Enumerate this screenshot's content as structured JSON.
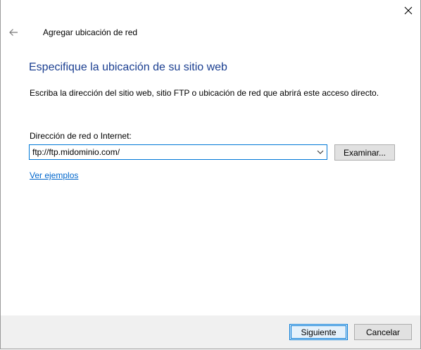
{
  "window": {
    "title": "Agregar ubicación de red",
    "close_icon": "close-icon",
    "back_icon": "back-arrow-icon"
  },
  "main": {
    "heading": "Especifique la ubicación de su sitio web",
    "description": "Escriba la dirección del sitio web, sitio FTP o ubicación de red que abrirá este acceso directo.",
    "address_label": "Dirección de red o Internet:",
    "address_value": "ftp://ftp.midominio.com/",
    "dropdown_icon": "chevron-down-icon",
    "browse_label": "Examinar...",
    "examples_link": "Ver ejemplos"
  },
  "footer": {
    "next_label": "Siguiente",
    "cancel_label": "Cancelar"
  },
  "colors": {
    "heading": "#1b3f91",
    "accent": "#0078d7",
    "link": "#0066cc",
    "footer_bg": "#f0f0f0",
    "button_bg": "#e1e1e1"
  }
}
